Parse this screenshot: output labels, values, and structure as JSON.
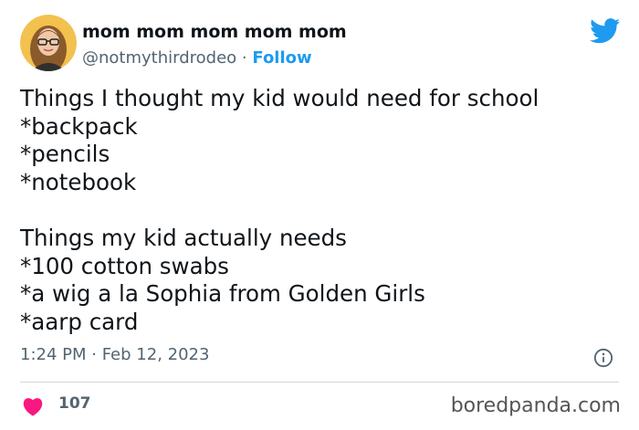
{
  "author": {
    "display_name": "mom mom mom mom mom",
    "handle": "@notmythirdrodeo",
    "separator": "·",
    "follow_label": "Follow"
  },
  "tweet": {
    "lines": [
      "Things I thought my kid would need for school",
      "*backpack",
      "*pencils",
      "*notebook",
      "",
      "Things my kid actually needs",
      "*100 cotton swabs",
      "*a wig a la Sophia from Golden Girls",
      "*aarp card"
    ]
  },
  "meta": {
    "timestamp": "1:24 PM · Feb 12, 2023"
  },
  "engagement": {
    "likes": "107"
  },
  "watermark": "boredpanda.com",
  "colors": {
    "accent": "#1d9bf0",
    "heart": "#f91880",
    "muted": "#536471"
  },
  "icons": {
    "brand": "twitter-bird-icon",
    "info": "info-icon",
    "like": "heart-icon"
  }
}
